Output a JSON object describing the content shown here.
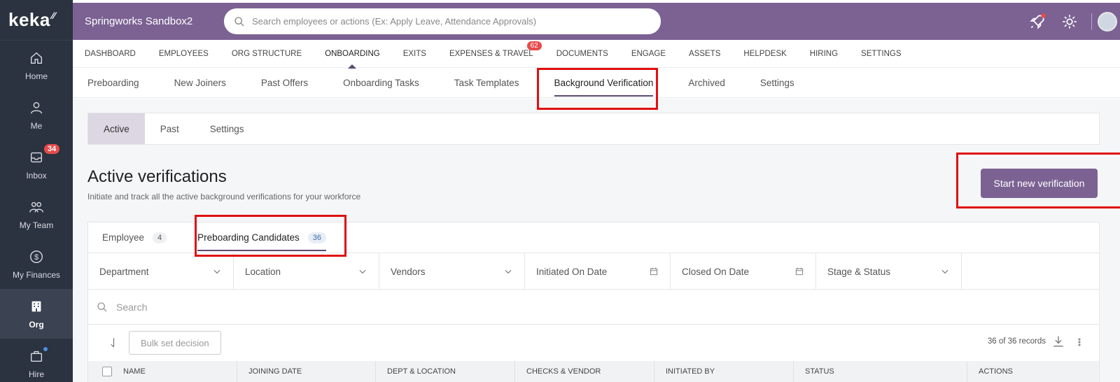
{
  "sidebar": {
    "logo": "keka",
    "items": [
      {
        "label": "Home",
        "icon": "home-icon"
      },
      {
        "label": "Me",
        "icon": "user-icon"
      },
      {
        "label": "Inbox",
        "icon": "inbox-icon",
        "badge": "34"
      },
      {
        "label": "My Team",
        "icon": "team-icon"
      },
      {
        "label": "My Finances",
        "icon": "finance-icon"
      },
      {
        "label": "Org",
        "icon": "org-icon"
      },
      {
        "label": "Hire",
        "icon": "briefcase-icon"
      }
    ]
  },
  "topbar": {
    "org_name": "Springworks Sandbox2",
    "search_placeholder": "Search employees or actions (Ex: Apply Leave, Attendance Approvals)"
  },
  "module_nav": {
    "items": [
      "DASHBOARD",
      "EMPLOYEES",
      "ORG STRUCTURE",
      "ONBOARDING",
      "EXITS",
      "EXPENSES & TRAVEL",
      "DOCUMENTS",
      "ENGAGE",
      "ASSETS",
      "HELPDESK",
      "HIRING",
      "SETTINGS"
    ],
    "active": "ONBOARDING",
    "expenses_badge": "62"
  },
  "sub_nav": {
    "items": [
      "Preboarding",
      "New Joiners",
      "Past Offers",
      "Onboarding Tasks",
      "Task Templates",
      "Background Verification",
      "Archived",
      "Settings"
    ],
    "active": "Background Verification"
  },
  "state_tabs": {
    "items": [
      "Active",
      "Past",
      "Settings"
    ],
    "active": "Active"
  },
  "page": {
    "title": "Active verifications",
    "subtitle": "Initiate and track all the active background verifications for your workforce",
    "primary_button": "Start new verification"
  },
  "panel_tabs": {
    "employee": {
      "label": "Employee",
      "count": "4"
    },
    "preboarding": {
      "label": "Preboarding Candidates",
      "count": "36"
    }
  },
  "filters": [
    "Department",
    "Location",
    "Vendors",
    "Initiated On Date",
    "Closed On Date",
    "Stage & Status"
  ],
  "search": {
    "placeholder": "Search"
  },
  "toolbar": {
    "bulk_button": "Bulk set decision",
    "records": "36 of 36 records"
  },
  "table": {
    "columns": [
      "NAME",
      "JOINING DATE",
      "DEPT & LOCATION",
      "CHECKS & VENDOR",
      "INITIATED BY",
      "STATUS",
      "ACTIONS"
    ]
  },
  "colors": {
    "brand": "#7b6293",
    "sidebar": "#2b3240",
    "annotation": "#e01010"
  }
}
